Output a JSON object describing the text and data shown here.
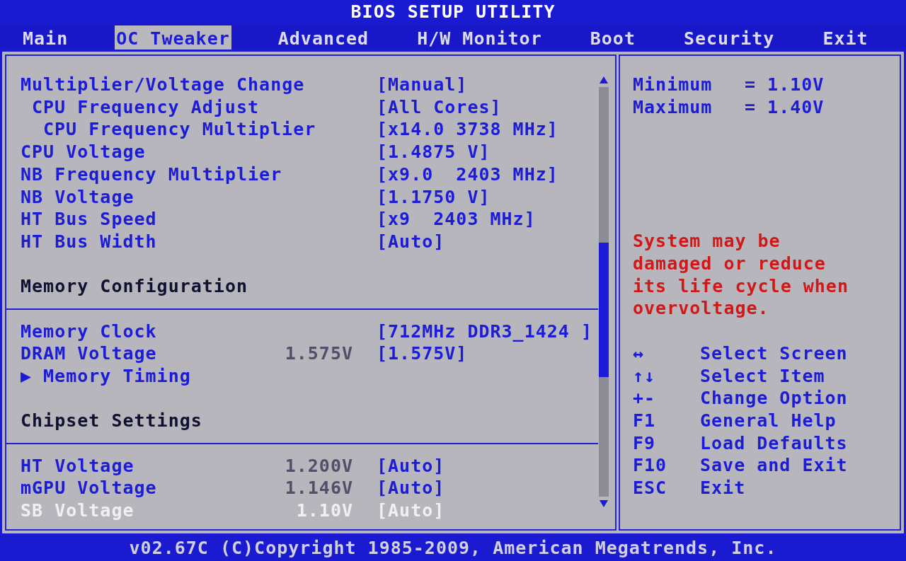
{
  "title": "BIOS SETUP UTILITY",
  "tabs": [
    {
      "label": "Main",
      "selected": false
    },
    {
      "label": "OC Tweaker",
      "selected": true
    },
    {
      "label": "Advanced",
      "selected": false
    },
    {
      "label": "H/W Monitor",
      "selected": false
    },
    {
      "label": "Boot",
      "selected": false
    },
    {
      "label": "Security",
      "selected": false
    },
    {
      "label": "Exit",
      "selected": false
    }
  ],
  "settings": [
    {
      "kind": "setting",
      "label": "Multiplier/Voltage Change",
      "value": "[Manual]",
      "selected": false,
      "children": [
        {
          "kind": "setting",
          "label": "CPU Frequency Adjust",
          "value": "[All Cores]",
          "selected": false,
          "children": [
            {
              "kind": "setting",
              "label": "CPU Frequency Multiplier",
              "value": "[x14.0 3738 MHz]",
              "selected": false
            }
          ]
        }
      ]
    },
    {
      "kind": "setting",
      "label": "CPU Voltage",
      "value": "[1.4875 V]",
      "selected": false
    },
    {
      "kind": "setting",
      "label": "NB Frequency Multiplier",
      "value": "[x9.0  2403 MHz]",
      "selected": false
    },
    {
      "kind": "setting",
      "label": "NB Voltage",
      "value": "[1.1750 V]",
      "selected": false
    },
    {
      "kind": "setting",
      "label": "HT Bus Speed",
      "value": "[x9  2403 MHz]",
      "selected": false
    },
    {
      "kind": "setting",
      "label": "HT Bus Width",
      "value": "[Auto]",
      "selected": false
    },
    {
      "kind": "header",
      "label": "Memory Configuration"
    },
    {
      "kind": "setting",
      "label": "Memory Clock",
      "value": "[712MHz DDR3_1424 ]",
      "selected": false
    },
    {
      "kind": "setting",
      "label": "DRAM Voltage",
      "current": "1.575V",
      "value": "[1.575V]",
      "selected": false
    },
    {
      "kind": "submenu",
      "marker": "▶",
      "label": "Memory Timing",
      "selected": false
    },
    {
      "kind": "header",
      "label": "Chipset Settings"
    },
    {
      "kind": "setting",
      "label": "HT Voltage",
      "current": "1.200V",
      "value": "[Auto]",
      "selected": false
    },
    {
      "kind": "setting",
      "label": "mGPU Voltage",
      "current": "1.146V",
      "value": "[Auto]",
      "selected": false
    },
    {
      "kind": "setting",
      "label": "SB Voltage",
      "current": "1.10V",
      "value": "[Auto]",
      "selected": true
    }
  ],
  "help": {
    "ranges": [
      {
        "name": "Minimum",
        "value": "= 1.10V"
      },
      {
        "name": "Maximum",
        "value": "= 1.40V"
      }
    ],
    "warning": "System may be damaged or reduce its life cycle when overvoltage."
  },
  "keys": [
    {
      "key": "↔",
      "action": "Select Screen"
    },
    {
      "key": "↑↓",
      "action": "Select Item"
    },
    {
      "key": "+-",
      "action": "Change Option"
    },
    {
      "key": "F1",
      "action": "General Help"
    },
    {
      "key": "F9",
      "action": "Load Defaults"
    },
    {
      "key": "F10",
      "action": "Save and Exit"
    },
    {
      "key": "ESC",
      "action": "Exit"
    }
  ],
  "footer": "v02.67C (C)Copyright 1985-2009, American Megatrends, Inc."
}
